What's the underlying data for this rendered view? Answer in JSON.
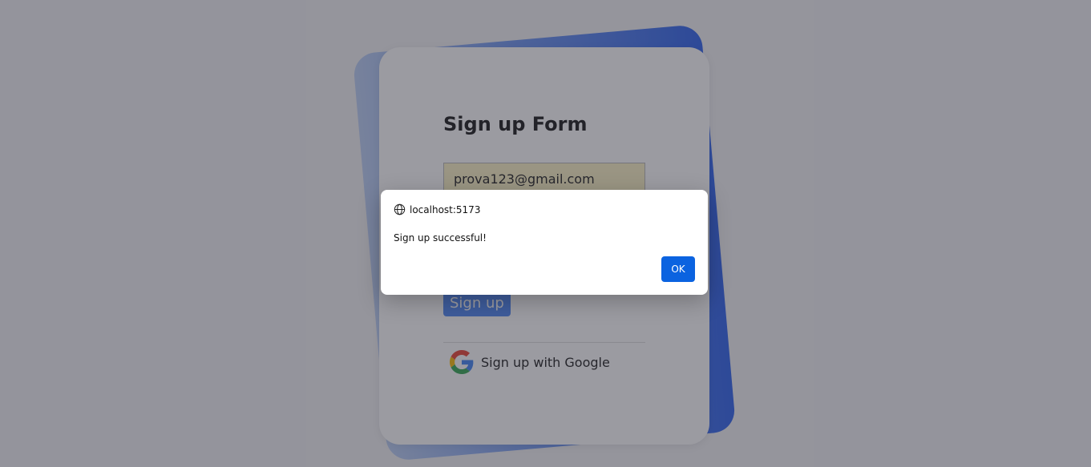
{
  "form": {
    "title": "Sign up Form",
    "email_value": "prova123@gmail.com",
    "signup_label": "Sign up",
    "google_label": "Sign up with Google"
  },
  "alert": {
    "origin": "localhost:5173",
    "message": "Sign up successful!",
    "ok_label": "OK"
  },
  "icons": {
    "google": "google-logo-icon",
    "origin": "globe-icon"
  },
  "colors": {
    "accent": "#4d86f3",
    "ok_button": "#0b63e0",
    "gradient_start": "#bcd0f5",
    "gradient_end": "#2e63ee",
    "autofill_bg": "#fdf4c6"
  }
}
